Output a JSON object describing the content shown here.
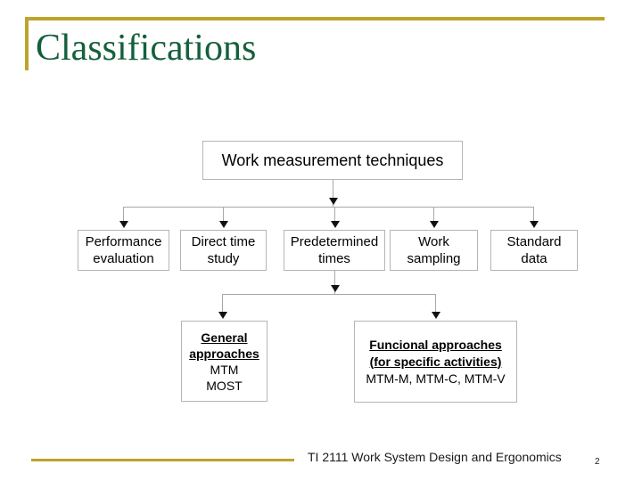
{
  "slide": {
    "title": "Classifications",
    "title_color": "#14603c",
    "accent_color": "#bfa32b",
    "background": "#ffffff"
  },
  "diagram": {
    "type": "tree",
    "node_border_color": "#b5b5b5",
    "connector_color": "#a8a8a8",
    "arrow_color": "#111111",
    "root": {
      "label": "Work measurement techniques"
    },
    "level2": [
      {
        "label_line1": "Performance",
        "label_line2": "evaluation"
      },
      {
        "label_line1": "Direct time",
        "label_line2": "study"
      },
      {
        "label_line1": "Predetermined",
        "label_line2": "times"
      },
      {
        "label_line1": "Work",
        "label_line2": "sampling"
      },
      {
        "label_line1": "Standard",
        "label_line2": "data"
      }
    ],
    "level3": [
      {
        "heading_line1": "General",
        "heading_line2": "approaches",
        "detail_line1": "MTM",
        "detail_line2": "MOST"
      },
      {
        "heading_line1": "Funcional approaches",
        "heading_line2": "(for  specific activities)",
        "detail_line1": "MTM-M, MTM-C, MTM-V",
        "detail_line2": ""
      }
    ]
  },
  "footer": {
    "text": "TI 2111 Work System Design and Ergonomics",
    "page_number": "2"
  }
}
